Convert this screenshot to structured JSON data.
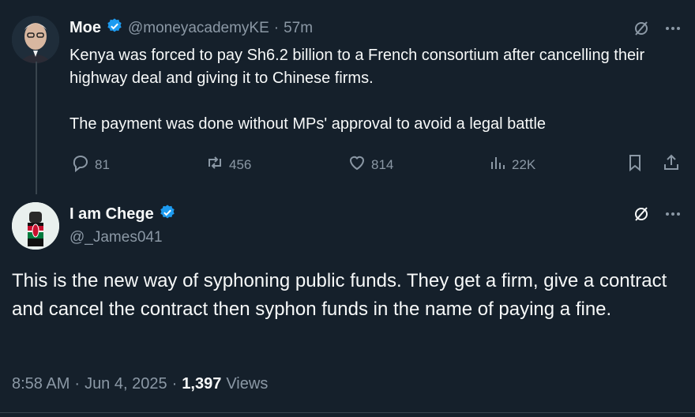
{
  "quoted": {
    "name": "Moe",
    "handle": "@moneyacademyKE",
    "sep": "·",
    "time": "57m",
    "text": "Kenya was forced to pay Sh6.2 billion to a French consortium after cancelling their highway deal and giving it to Chinese firms.\n\nThe payment was done without MPs' approval to avoid a legal battle",
    "replies": "81",
    "reposts": "456",
    "likes": "814",
    "views": "22K"
  },
  "main": {
    "name": "I am Chege",
    "handle": "@_James041",
    "text": "This is the new way of syphoning public funds. They get a firm, give a contract and cancel the contract then syphon funds in the name of paying a fine.",
    "time": "8:58 AM",
    "date": "Jun 4, 2025",
    "sep1": "·",
    "sep2": "·",
    "view_count": "1,397",
    "views_label": "Views"
  },
  "icons": {
    "verified": "verified-badge-icon",
    "grok": "grok-icon",
    "more": "more-icon",
    "reply": "reply-icon",
    "repost": "repost-icon",
    "like": "like-icon",
    "views": "views-icon",
    "bookmark": "bookmark-icon",
    "share": "share-icon"
  },
  "colors": {
    "background": "#15202b",
    "verified": "#1d9bf0",
    "secondary_text": "#8b98a5"
  }
}
